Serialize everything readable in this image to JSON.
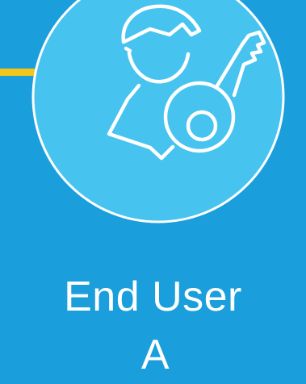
{
  "palette": {
    "background": "#1a9fdc",
    "circle_fill": "#47c3f0",
    "stroke": "#ffffff",
    "accent": "#f6c51a"
  },
  "icon": {
    "name": "user-key-icon"
  },
  "title": {
    "line1": "End User",
    "line2": "A"
  }
}
